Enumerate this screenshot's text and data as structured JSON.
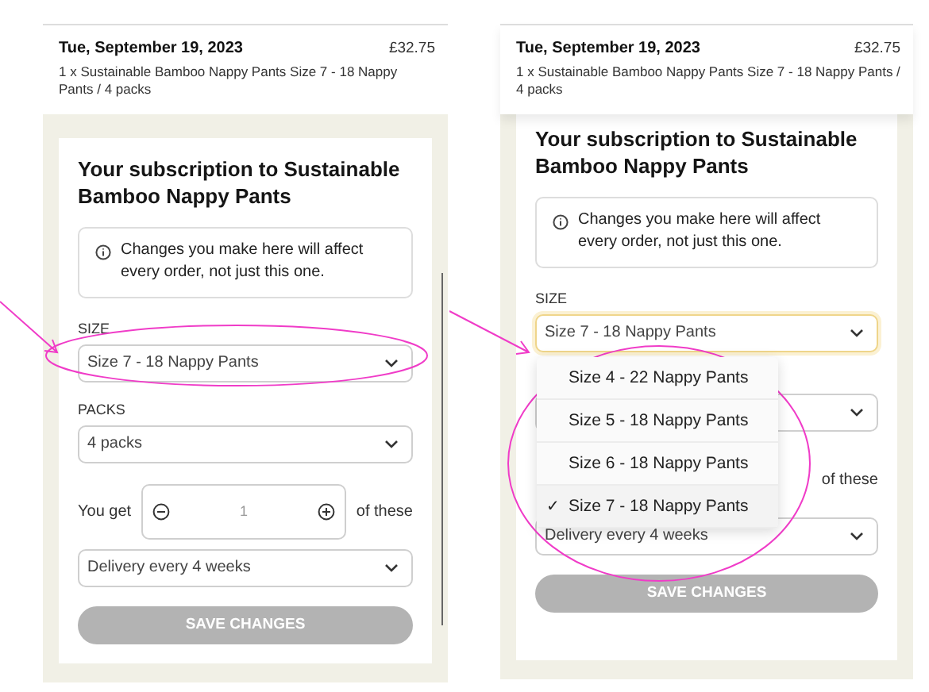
{
  "screens": [
    {
      "header": {
        "date": "Tue, September 19, 2023",
        "price": "£32.75",
        "description": "1 x Sustainable Bamboo Nappy Pants Size 7 - 18 Nappy Pants / 4 packs"
      },
      "title": "Your subscription to Sustainable Bamboo Nappy Pants",
      "notice": "Changes you make here will affect every order, not just this one.",
      "fields": [
        {
          "kind": "select",
          "label": "SIZE",
          "value": "Size 7 - 18 Nappy Pants",
          "open": false
        },
        {
          "kind": "select",
          "label": "PACKS",
          "value": "4 packs",
          "open": false
        },
        {
          "kind": "stepper",
          "prefix": "You get",
          "value": "1",
          "suffix": "of these"
        },
        {
          "kind": "select",
          "value": "Delivery every 4 weeks",
          "open": false
        },
        {
          "kind": "button",
          "label": "SAVE CHANGES",
          "disabled": true
        }
      ]
    },
    {
      "header": {
        "date": "Tue, September 19, 2023",
        "price": "£32.75",
        "description": "1 x Sustainable Bamboo Nappy Pants Size 7 - 18 Nappy Pants / 4 packs"
      },
      "title": "Your subscription to Sustainable Bamboo Nappy Pants",
      "notice": "Changes you make here will affect every order, not just this one.",
      "fields": [
        {
          "kind": "select",
          "label": "SIZE",
          "value": "Size 7 - 18 Nappy Pants",
          "open": true,
          "check_mark": "✓",
          "options": [
            {
              "label": "Size 4 - 22 Nappy Pants",
              "selected": false
            },
            {
              "label": "Size 5 - 18 Nappy Pants",
              "selected": false
            },
            {
              "label": "Size 6 - 18 Nappy Pants",
              "selected": false
            },
            {
              "label": "Size 7 - 18 Nappy Pants",
              "selected": true
            }
          ]
        },
        {
          "kind": "select",
          "open": false
        },
        {
          "kind": "stepper",
          "suffix": "of these"
        },
        {
          "kind": "select",
          "value": "Delivery every 4 weeks",
          "open": false
        },
        {
          "kind": "button",
          "label": "SAVE CHANGES",
          "disabled": true
        }
      ]
    }
  ]
}
